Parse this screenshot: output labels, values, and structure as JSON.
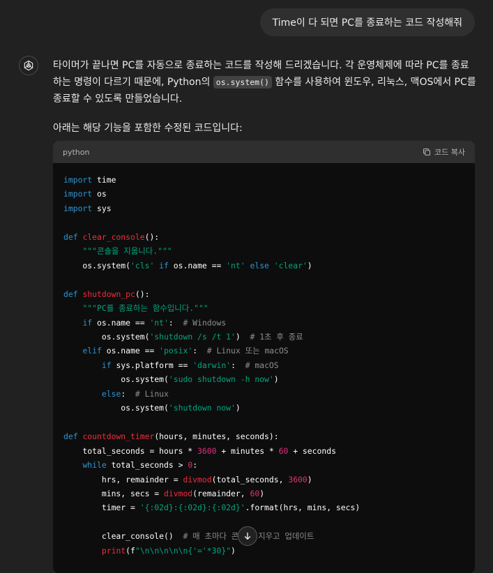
{
  "user_message": "Time이 다 되면 PC를 종료하는 코드 작성해줘",
  "assistant": {
    "intro_before": "타이머가 끝나면 PC를 자동으로 종료하는 코드를 작성해 드리겠습니다. 각 운영체제에 따라 PC를 종료하는 명령이 다르기 때문에, Python의 ",
    "inline_code": "os.system()",
    "intro_after": " 함수를 사용하여 윈도우, 리눅스, 맥OS에서 PC를 종료할 수 있도록 만들었습니다.",
    "lead_in": "아래는 해당 기능을 포함한 수정된 코드입니다:"
  },
  "code_block": {
    "language": "python",
    "copy_label": "코드 복사",
    "code": "import time\nimport os\nimport sys\n\ndef clear_console():\n    \"\"\"콘솔을 지웁니다.\"\"\"\n    os.system('cls' if os.name == 'nt' else 'clear')\n\ndef shutdown_pc():\n    \"\"\"PC를 종료하는 함수입니다.\"\"\"\n    if os.name == 'nt':  # Windows\n        os.system('shutdown /s /t 1')  # 1초 후 종료\n    elif os.name == 'posix':  # Linux 또는 macOS\n        if sys.platform == 'darwin':  # macOS\n            os.system('sudo shutdown -h now')\n        else:  # Linux\n            os.system('shutdown now')\n\ndef countdown_timer(hours, minutes, seconds):\n    total_seconds = hours * 3600 + minutes * 60 + seconds\n    while total_seconds > 0:\n        hrs, remainder = divmod(total_seconds, 3600)\n        mins, secs = divmod(remainder, 60)\n        timer = '{:02d}:{:02d}:{:02d}'.format(hrs, mins, secs)\n\n        clear_console()  # 매 초마다 콘솔을 지우고 업데이트\n        print(f\"\\n\\n\\n\\n\\n{'='*30}\")"
  },
  "icons": {
    "assistant_avatar": "openai-logo-icon",
    "copy": "copy-icon",
    "scroll_down": "arrow-down-icon"
  },
  "colors": {
    "background": "#212121",
    "user_bubble": "#2f2f2f",
    "code_background": "#0d0d0d",
    "code_header": "#2f2f2f",
    "keyword": "#2e95d3",
    "function_name": "#f22c3d",
    "string": "#00a67d",
    "number": "#df3079",
    "comment": "#8e8e8e"
  }
}
